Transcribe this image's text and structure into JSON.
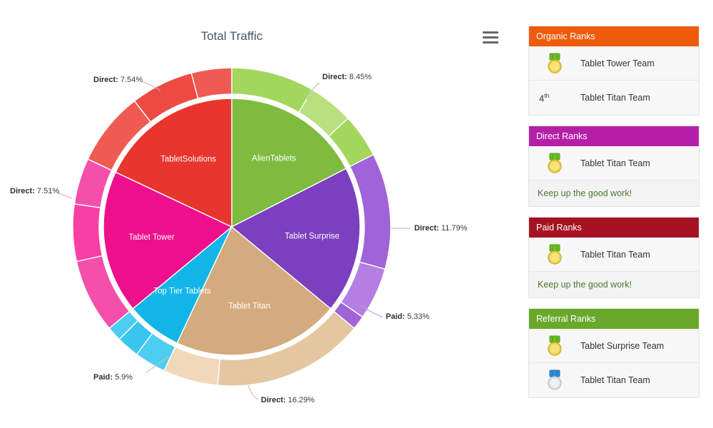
{
  "chart": {
    "title": "Total Traffic",
    "menu_icon": "hamburger-menu-icon"
  },
  "chart_data": {
    "type": "pie",
    "title": "Total Traffic",
    "variant": "donut-with-outer-ring",
    "legend": "none",
    "inner_labels_shown": true,
    "categories": [
      "AlienTablets",
      "Tablet Surprise",
      "Tablet Titan",
      "Top Tier Tablets",
      "Tablet Tower",
      "TabletSolutions"
    ],
    "values": [
      17.5,
      18.5,
      21.0,
      7.0,
      18.0,
      18.0
    ],
    "colors": [
      "#7fbb3f",
      "#7b3fbf",
      "#d3ab7e",
      "#12b5e8",
      "#ee0f8c",
      "#e8352e"
    ],
    "inner_slices": [
      {
        "label": "AlienTablets",
        "value": 17.5,
        "color": "#7fbb3f"
      },
      {
        "label": "Tablet Surprise",
        "value": 18.5,
        "color": "#7b3fbf"
      },
      {
        "label": "Tablet Titan",
        "value": 21.0,
        "color": "#d3ab7e"
      },
      {
        "label": "Top Tier Tablets",
        "value": 7.0,
        "color": "#12b5e8"
      },
      {
        "label": "Tablet Tower",
        "value": 18.0,
        "color": "#ee0f8c"
      },
      {
        "label": "TabletSolutions",
        "value": 18.0,
        "color": "#e8352e"
      }
    ],
    "outer_ring_segments": [
      {
        "parent": "AlienTablets",
        "value": 8.45,
        "color": "#a3d65c",
        "label": "Direct: 8.45%"
      },
      {
        "parent": "AlienTablets",
        "value": 4.6,
        "color": "#b9e07e",
        "label": ""
      },
      {
        "parent": "AlienTablets",
        "value": 4.45,
        "color": "#a3d65c",
        "label": ""
      },
      {
        "parent": "Tablet Surprise",
        "value": 11.79,
        "color": "#a063d8",
        "label": "Direct: 11.79%"
      },
      {
        "parent": "Tablet Surprise",
        "value": 5.33,
        "color": "#b57ee2",
        "label": "Paid: 5.33%"
      },
      {
        "parent": "Tablet Surprise",
        "value": 1.4,
        "color": "#a063d8",
        "label": ""
      },
      {
        "parent": "Tablet Titan",
        "value": 16.29,
        "color": "#e4c6a0",
        "label": "Direct: 16.29%"
      },
      {
        "parent": "Tablet Titan",
        "value": 5.9,
        "color": "#f0d8b9",
        "label": "Paid: 5.9%"
      },
      {
        "parent": "Top Tier Tablets",
        "value": 3.2,
        "color": "#4ecdf2",
        "label": ""
      },
      {
        "parent": "Top Tier Tablets",
        "value": 2.3,
        "color": "#38c6f0",
        "label": ""
      },
      {
        "parent": "Top Tier Tablets",
        "value": 1.5,
        "color": "#4ecdf2",
        "label": ""
      },
      {
        "parent": "Tablet Tower",
        "value": 7.51,
        "color": "#f54fac",
        "label": "Direct: 7.51%"
      },
      {
        "parent": "Tablet Tower",
        "value": 5.8,
        "color": "#f73fa4",
        "label": ""
      },
      {
        "parent": "Tablet Tower",
        "value": 4.7,
        "color": "#f54fac",
        "label": ""
      },
      {
        "parent": "TabletSolutions",
        "value": 7.54,
        "color": "#ef5a52",
        "label": "Direct: 7.54%"
      },
      {
        "parent": "TabletSolutions",
        "value": 6.4,
        "color": "#ec4a42",
        "label": ""
      },
      {
        "parent": "TabletSolutions",
        "value": 4.1,
        "color": "#ef5a52",
        "label": ""
      }
    ],
    "callouts": [
      {
        "key": "Direct:",
        "value": "8.45%",
        "name": "callout-direct-845"
      },
      {
        "key": "Direct:",
        "value": "11.79%",
        "name": "callout-direct-1179"
      },
      {
        "key": "Paid:",
        "value": "5.33%",
        "name": "callout-paid-533"
      },
      {
        "key": "Direct:",
        "value": "16.29%",
        "name": "callout-direct-1629"
      },
      {
        "key": "Paid:",
        "value": "5.9%",
        "name": "callout-paid-59"
      },
      {
        "key": "Direct:",
        "value": "7.51%",
        "name": "callout-direct-751"
      },
      {
        "key": "Direct:",
        "value": "7.54%",
        "name": "callout-direct-754"
      }
    ]
  },
  "ranks": {
    "panels": [
      {
        "title": "Organic Ranks",
        "color": "#ef5b0c",
        "rows": [
          {
            "icon": "gold-medal-icon",
            "ordinal": "",
            "name": "Tablet Tower Team"
          },
          {
            "icon": "",
            "ordinal": "4",
            "ordinal_suffix": "th",
            "name": "Tablet Titan Team"
          }
        ],
        "note": ""
      },
      {
        "title": "Direct Ranks",
        "color": "#b51fa8",
        "rows": [
          {
            "icon": "gold-medal-icon",
            "ordinal": "",
            "name": "Tablet Titan Team"
          }
        ],
        "note": "Keep up the good work!"
      },
      {
        "title": "Paid Ranks",
        "color": "#a61221",
        "rows": [
          {
            "icon": "gold-medal-icon",
            "ordinal": "",
            "name": "Tablet Titan Team"
          }
        ],
        "note": "Keep up the good work!"
      },
      {
        "title": "Referral Ranks",
        "color": "#6aa82b",
        "rows": [
          {
            "icon": "gold-medal-icon",
            "ordinal": "",
            "name": "Tablet Surprise Team"
          },
          {
            "icon": "silver-medal-icon",
            "ordinal": "",
            "name": "Tablet Titan Team"
          }
        ],
        "note": ""
      }
    ]
  }
}
